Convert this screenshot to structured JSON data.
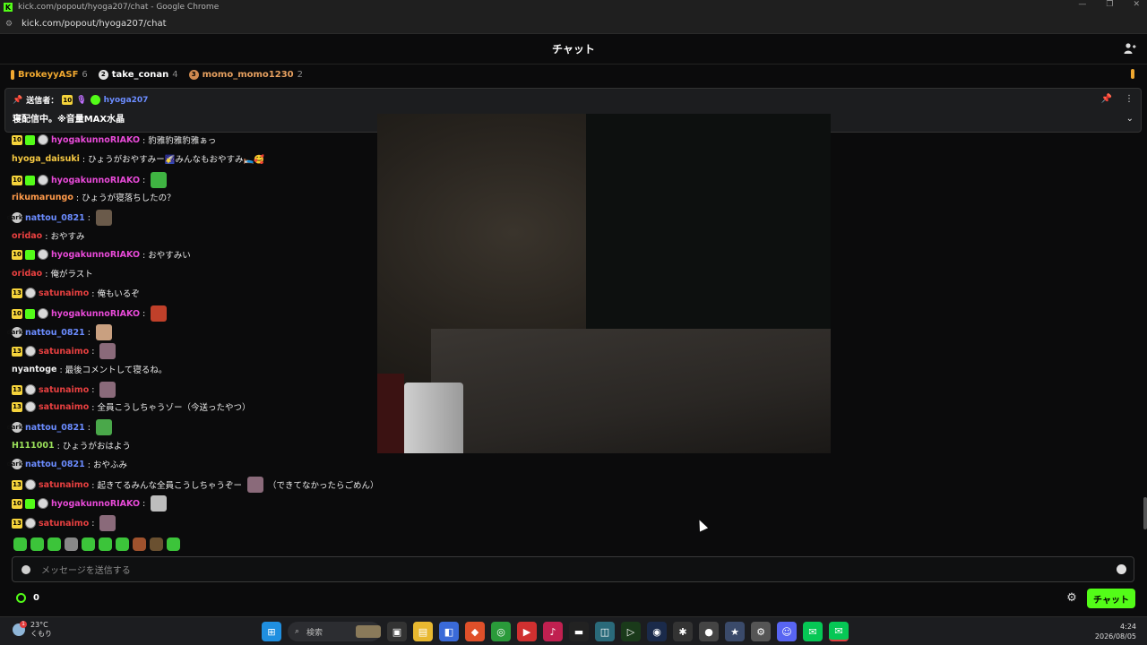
{
  "window": {
    "title": "kick.com/popout/hyoga207/chat - Google Chrome",
    "url": "kick.com/popout/hyoga207/chat",
    "controls": [
      "—",
      "❐",
      "✕"
    ]
  },
  "header": {
    "title": "チャット"
  },
  "leaderboard": [
    {
      "rank": "",
      "name": "BrokeyyASF",
      "count": "6",
      "color": "#f0a830"
    },
    {
      "rank": "2",
      "name": "take_conan",
      "count": "4",
      "color": "#ffffff"
    },
    {
      "rank": "3",
      "name": "momo_momo1230",
      "count": "2",
      "color": "#e6a060"
    }
  ],
  "pinned": {
    "label": "送信者：",
    "badge": "10",
    "user": "hyoga207",
    "user_color": "#6b8cff",
    "message": "寝配信中。※音量MAX水晶"
  },
  "messages": [
    {
      "badges": [
        "10",
        "green",
        "round"
      ],
      "user": "hyogakunnoRIAKO",
      "color": "#e84ad8",
      "text": ": 豹雅豹雅豹雅ぁっ"
    },
    {
      "badges": [],
      "user": "hyoga_daisuki",
      "color": "#f5c842",
      "text": ": ひょうがおやすみー🌠みんなもおやすみ🛌🥰"
    },
    {
      "badges": [
        "10",
        "green",
        "round"
      ],
      "user": "hyogakunnoRIAKO",
      "color": "#e84ad8",
      "text": ":",
      "emote": "#3fb442"
    },
    {
      "badges": [],
      "user": "rikumarungo",
      "color": "#ff9a4a",
      "text": ": ひょうが寝落ちしたの？"
    },
    {
      "badges": [
        "dark9"
      ],
      "user": "nattou_0821",
      "color": "#6b8cff",
      "text": ":",
      "emote": "#6a5a4a"
    },
    {
      "badges": [],
      "user": "oridao",
      "color": "#e84040",
      "text": ": おやすみ"
    },
    {
      "badges": [
        "10",
        "green",
        "round"
      ],
      "user": "hyogakunnoRIAKO",
      "color": "#e84ad8",
      "text": ": おやすみい"
    },
    {
      "badges": [],
      "user": "oridao",
      "color": "#e84040",
      "text": ": 俺がラスト"
    },
    {
      "badges": [
        "13",
        "round"
      ],
      "user": "satunaimo",
      "color": "#e84040",
      "text": ": 俺もいるぞ"
    },
    {
      "badges": [
        "10",
        "green",
        "round"
      ],
      "user": "hyogakunnoRIAKO",
      "color": "#e84ad8",
      "text": ":",
      "emote": "#c0402a"
    },
    {
      "badges": [
        "dark9"
      ],
      "user": "nattou_0821",
      "color": "#6b8cff",
      "text": ":",
      "emote": "#c9a080"
    },
    {
      "badges": [
        "13",
        "round"
      ],
      "user": "satunaimo",
      "color": "#e84040",
      "text": ":",
      "emote": "#8a6a7a"
    },
    {
      "badges": [],
      "user": "nyantoge",
      "color": "#f0f0f0",
      "text": ": 最後コメントして寝るね。"
    },
    {
      "badges": [
        "13",
        "round"
      ],
      "user": "satunaimo",
      "color": "#e84040",
      "text": ":",
      "emote": "#8a6a7a"
    },
    {
      "badges": [
        "13",
        "round"
      ],
      "user": "satunaimo",
      "color": "#e84040",
      "text": ": 全員こうしちゃうゾー（今送ったやつ）"
    },
    {
      "badges": [
        "dark9"
      ],
      "user": "nattou_0821",
      "color": "#6b8cff",
      "text": ":",
      "emote": "#4aa84a"
    },
    {
      "badges": [],
      "user": "H111001",
      "color": "#9be05a",
      "text": ": ひょうがおはよう"
    },
    {
      "badges": [
        "dark9"
      ],
      "user": "nattou_0821",
      "color": "#6b8cff",
      "text": ": おやふみ"
    },
    {
      "badges": [
        "13",
        "round"
      ],
      "user": "satunaimo",
      "color": "#e84040",
      "text": ": 起きてるみんな全員こうしちゃうぞー",
      "emote": "#8a6a7a",
      "text_after": "（できてなかったらごめん）"
    },
    {
      "badges": [
        "10",
        "green",
        "round"
      ],
      "user": "hyogakunnoRIAKO",
      "color": "#e84ad8",
      "text": ":",
      "emote": "#bdbdbd"
    },
    {
      "badges": [
        "13",
        "round"
      ],
      "user": "satunaimo",
      "color": "#e84040",
      "text": ":",
      "emote": "#8a6a7a"
    }
  ],
  "composer": {
    "placeholder": "メッセージを送信する"
  },
  "bottom": {
    "points": "0",
    "chat_button": "チャット"
  },
  "taskbar": {
    "weather_temp": "23°C",
    "weather_desc": "くもり",
    "notif_count": "1",
    "search_label": "検索",
    "time": "4:24",
    "date": "2026/08/05"
  },
  "colors": {
    "accent": "#53fc18",
    "background": "#0b0b0c"
  }
}
